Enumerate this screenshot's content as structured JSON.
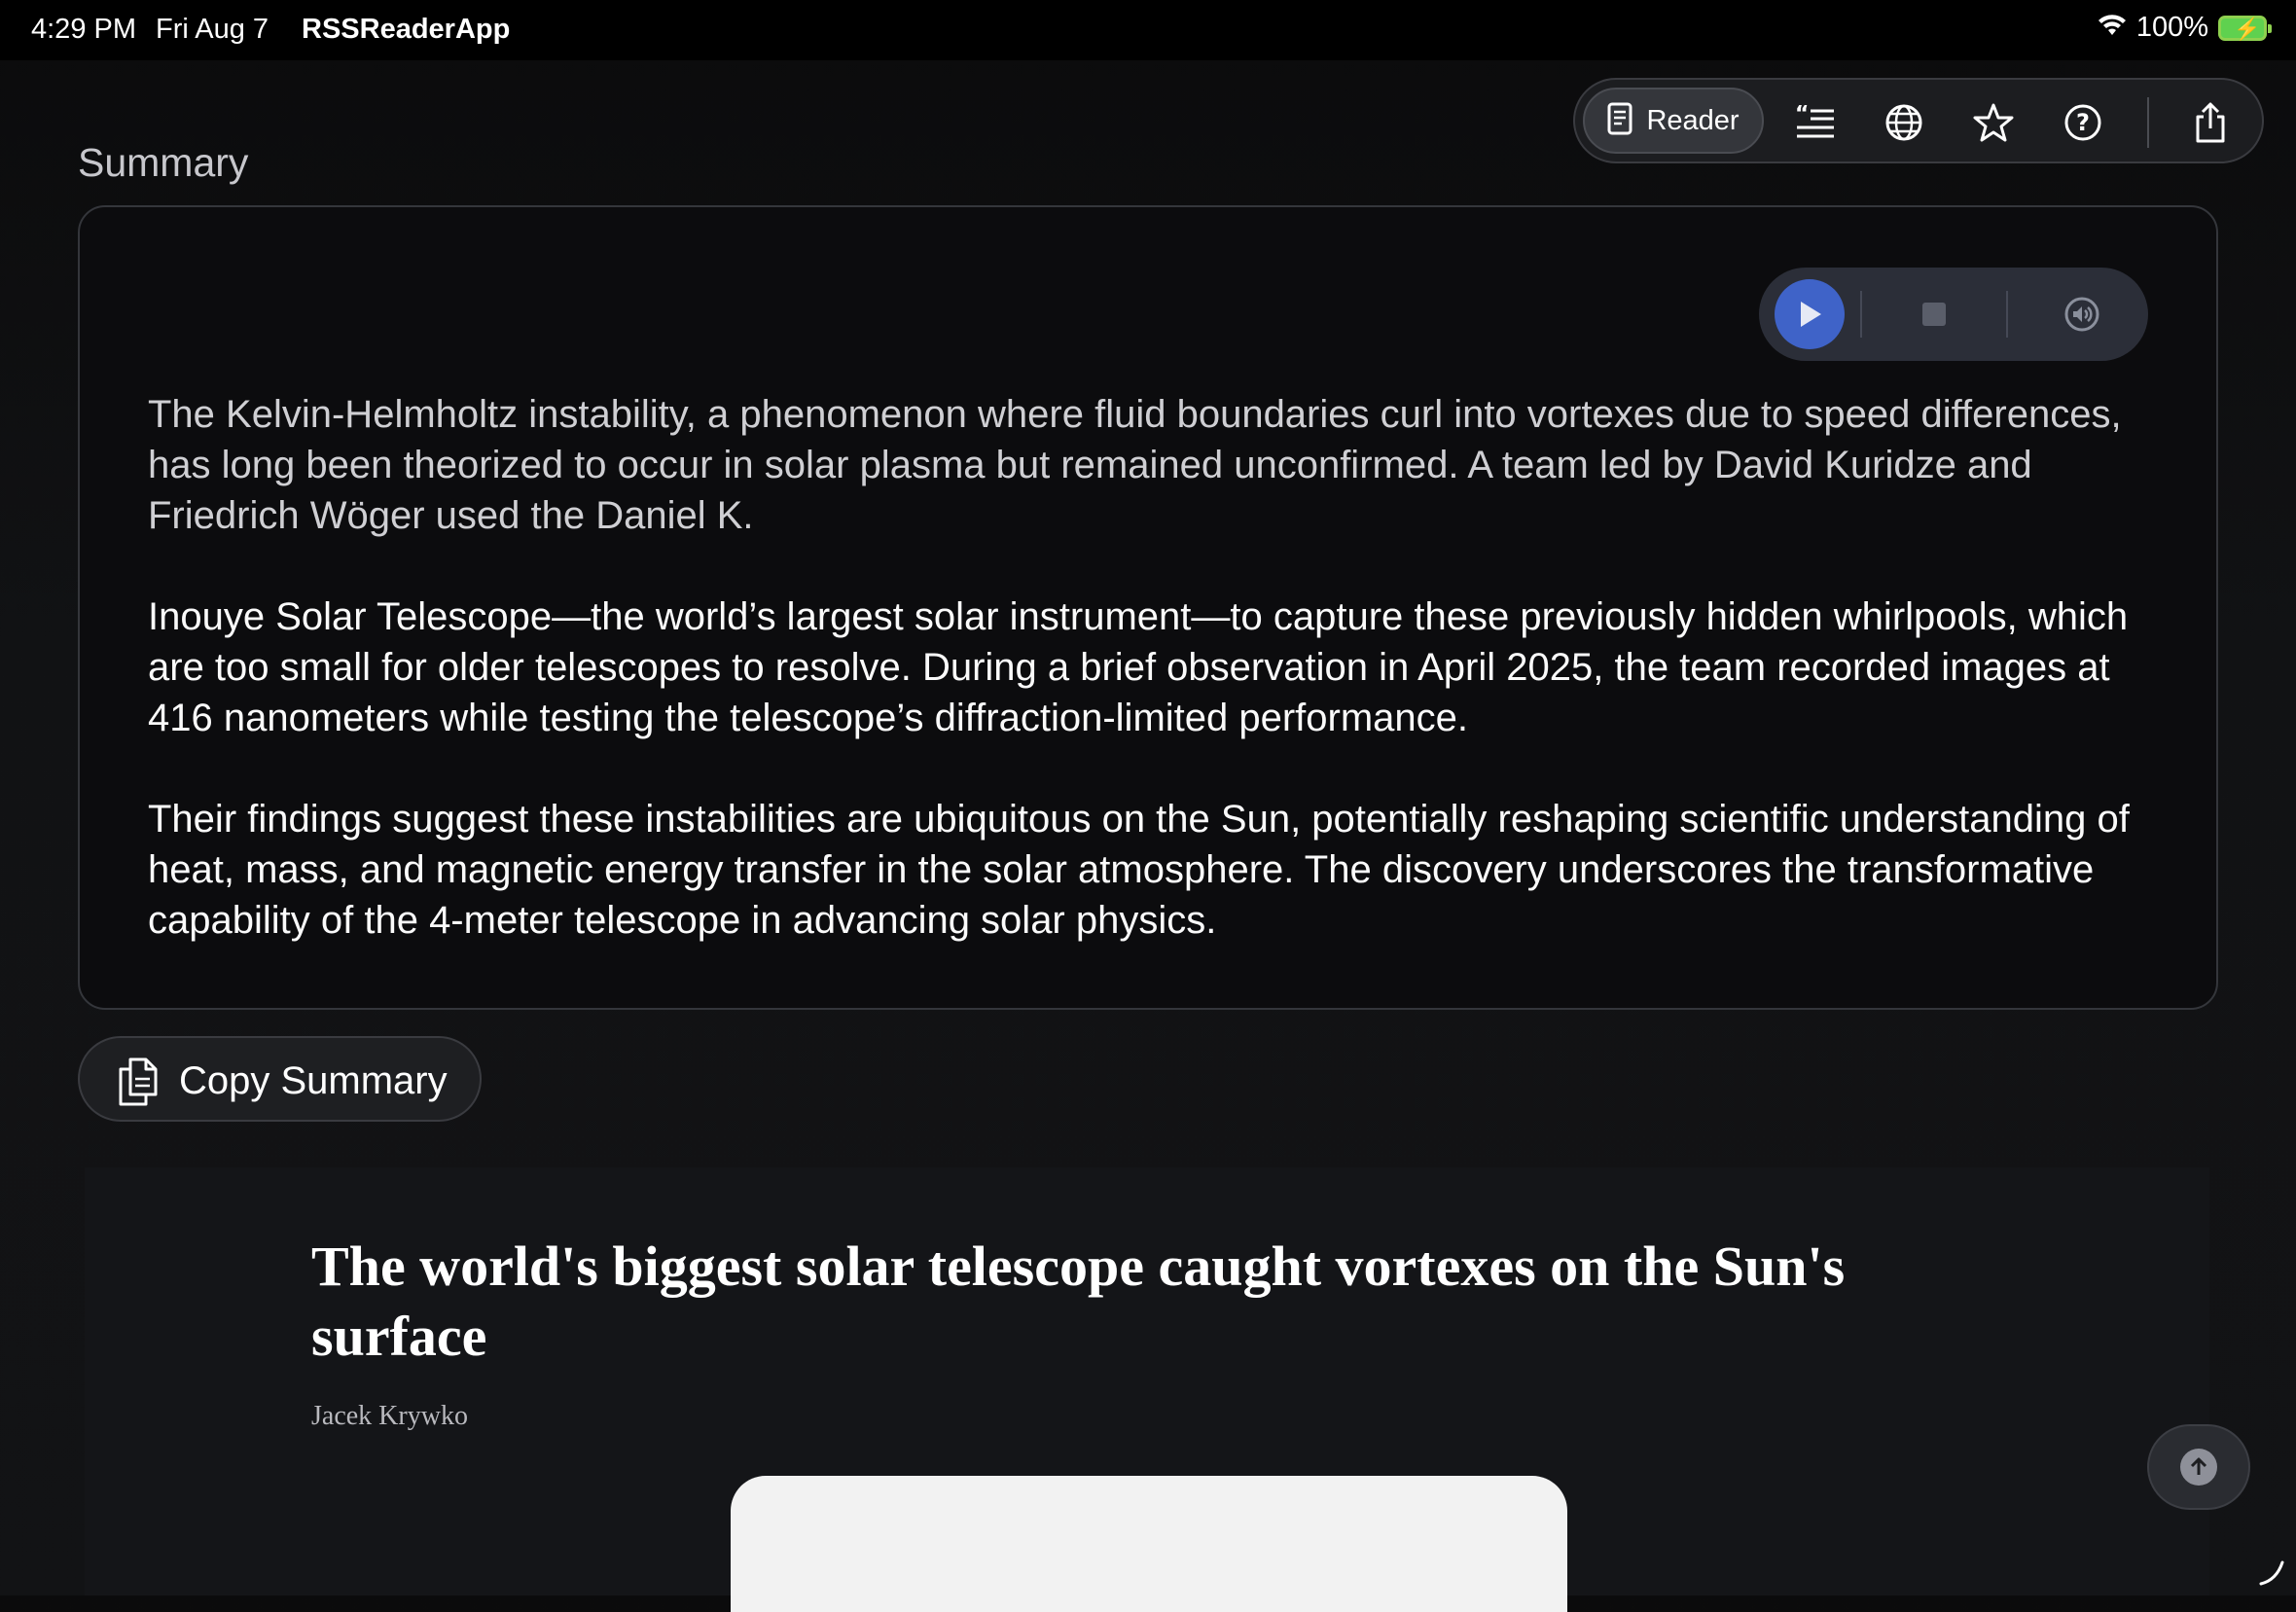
{
  "status_bar": {
    "time": "4:29 PM",
    "date": "Fri Aug 7",
    "app": "RSSReaderApp",
    "battery": "100%"
  },
  "toolbar": {
    "reader_label": "Reader",
    "icons": [
      "reader-page-icon",
      "quote-list-icon",
      "globe-icon",
      "star-icon",
      "help-icon",
      "share-icon"
    ]
  },
  "summary": {
    "label": "Summary",
    "paragraphs": [
      "The Kelvin-Helmholtz instability, a phenomenon where fluid boundaries curl into vortexes due to speed differences, has long been theorized to occur in solar plasma but remained unconfirmed. A team led by David Kuridze and Friedrich Wöger used the Daniel K.",
      "Inouye Solar Telescope—the world’s largest solar instrument—to capture these previously hidden whirlpools, which are too small for older telescopes to resolve. During a brief observation in April 2025, the team recorded images at 416 nanometers while testing the telescope’s diffraction-limited performance.",
      "Their findings suggest these instabilities are ubiquitous on the Sun, potentially reshaping scientific understanding of heat, mass, and magnetic energy transfer in the solar atmosphere. The discovery underscores the transformative capability of the 4-meter telescope in advancing solar physics."
    ],
    "copy_label": "Copy Summary"
  },
  "article": {
    "title": "The world's biggest solar telescope caught vortexes on the Sun's surface",
    "author": "Jacek Krywko"
  },
  "colors": {
    "accent": "#3f63c8",
    "background": "#111214",
    "card_border": "#34363b"
  }
}
